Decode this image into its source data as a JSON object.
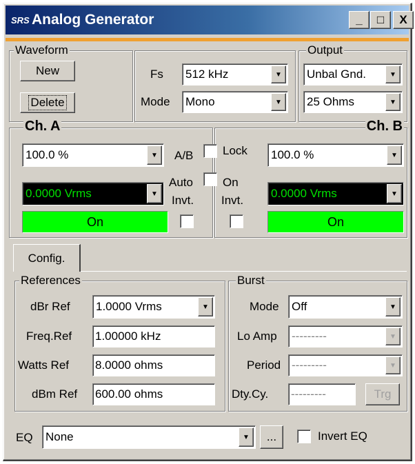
{
  "window": {
    "title": "Analog Generator",
    "app_icon": "SRS"
  },
  "titlebar_buttons": {
    "minimize": "_",
    "maximize": "□",
    "close": "X"
  },
  "waveform": {
    "legend": "Waveform",
    "new_label": "New",
    "delete_label": "Delete"
  },
  "fs": {
    "label": "Fs",
    "value": "512 kHz",
    "mode_label": "Mode",
    "mode_value": "Mono"
  },
  "output": {
    "legend": "Output",
    "type_value": "Unbal Gnd.",
    "impedance_value": "25 Ohms"
  },
  "ch_a": {
    "legend": "Ch. A",
    "amplitude_value": "100.0 %",
    "level_value": "0.0000 Vrms",
    "on_label": "On"
  },
  "ch_b": {
    "legend": "Ch. B",
    "amplitude_value": "100.0 %",
    "level_value": "0.0000 Vrms",
    "on_label": "On"
  },
  "center": {
    "ab_label": "A/B",
    "lock_label": "Lock",
    "auto_label": "Auto",
    "on_label": "On",
    "invt_a_label": "Invt.",
    "invt_b_label": "Invt."
  },
  "tabs": {
    "config_label": "Config."
  },
  "references": {
    "legend": "References",
    "dbr_label": "dBr Ref",
    "dbr_value": "1.0000 Vrms",
    "freq_label": "Freq.Ref",
    "freq_value": "1.00000 kHz",
    "watts_label": "Watts Ref",
    "watts_value": "8.0000 ohms",
    "dbm_label": "dBm Ref",
    "dbm_value": "600.00 ohms"
  },
  "burst": {
    "legend": "Burst",
    "mode_label": "Mode",
    "mode_value": "Off",
    "lo_amp_label": "Lo Amp",
    "lo_amp_value": "---------",
    "period_label": "Period",
    "period_value": "---------",
    "dty_label": "Dty.Cy.",
    "dty_value": "---------",
    "trg_label": "Trg"
  },
  "eq": {
    "label": "EQ",
    "value": "None",
    "more_label": "...",
    "invert_label": "Invert EQ"
  },
  "colors": {
    "window_bg": "#d4d0c8",
    "titlebar": "#0a246a",
    "accent_strip": "#f0a030",
    "on_green": "#00ff00",
    "level_text": "#00e000"
  },
  "icons": {
    "dropdown": "triangle-down",
    "checkbox": "empty-square"
  }
}
